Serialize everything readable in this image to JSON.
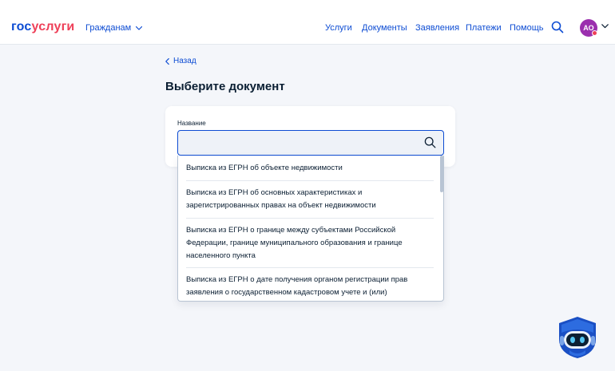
{
  "header": {
    "logo_part1": "гос",
    "logo_part2": "услуги",
    "audience_label": "Гражданам",
    "nav": [
      "Услуги",
      "Документы",
      "Заявления",
      "Платежи",
      "Помощь"
    ],
    "avatar_initials": "АО"
  },
  "page": {
    "back_label": "Назад",
    "title": "Выберите документ"
  },
  "search_field": {
    "label": "Название",
    "value": "",
    "placeholder": ""
  },
  "dropdown": {
    "options": [
      {
        "lines": [
          "Выписка из ЕГРН об объекте недвижимости"
        ]
      },
      {
        "lines": [
          "Выписка из ЕГРН об основных характеристиках и",
          "зарегистрированных правах на объект недвижимости"
        ]
      },
      {
        "lines": [
          "Выписка из ЕГРН о границе между субъектами Российской",
          "Федерации, границе муниципального образования и границе",
          "населенного пункта"
        ]
      },
      {
        "lines": [
          "Выписка из ЕГРН о дате получения органом регистрации прав",
          "заявления о государственном кадастровом учете и (или)"
        ]
      }
    ]
  },
  "colors": {
    "brand_blue": "#0d4cd3",
    "brand_red": "#ee3f58",
    "avatar_bg": "#9b2fae",
    "background": "#f4f6fa"
  }
}
